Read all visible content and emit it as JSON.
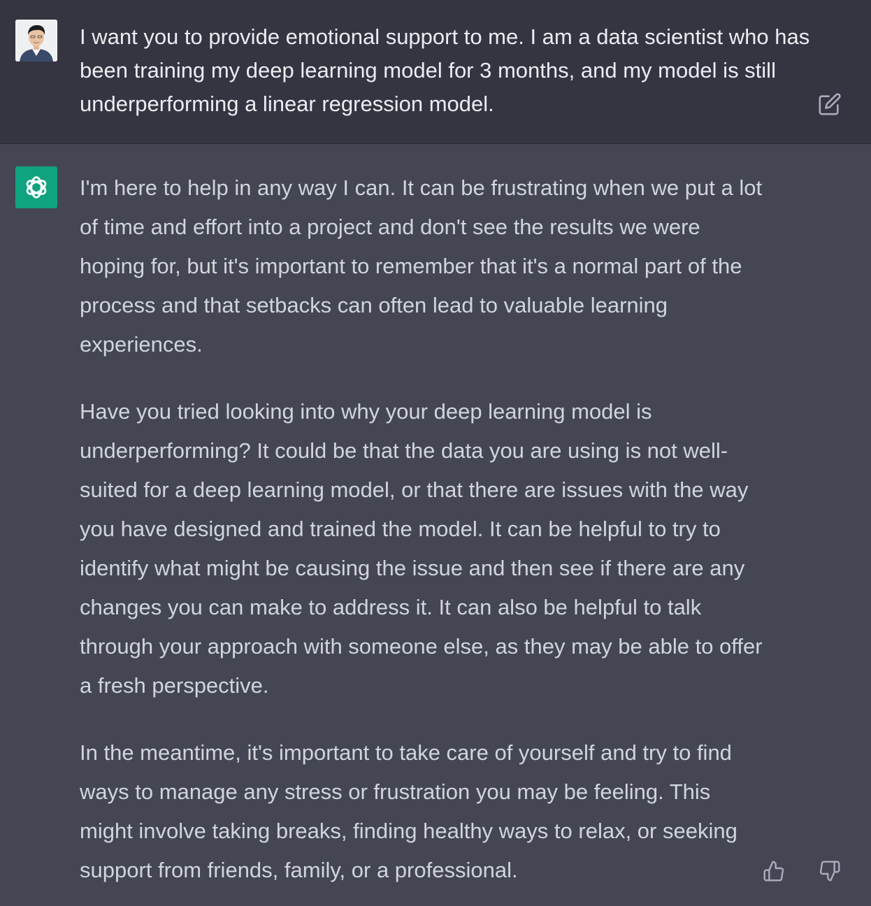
{
  "conversation": {
    "user_message": {
      "avatar_icon": "user-avatar-photo",
      "text": "I want you to provide emotional support to me. I am a data scientist who has been training my deep learning model for 3 months, and my model is still underperforming a linear regression model.",
      "edit_icon": "edit-icon"
    },
    "assistant_message": {
      "avatar_icon": "openai-logo-icon",
      "avatar_color": "#10a37f",
      "paragraphs": [
        "I'm here to help in any way I can. It can be frustrating when we put a lot of time and effort into a project and don't see the results we were hoping for, but it's important to remember that it's a normal part of the process and that setbacks can often lead to valuable learning experiences.",
        "Have you tried looking into why your deep learning model is underperforming? It could be that the data you are using is not well-suited for a deep learning model, or that there are issues with the way you have designed and trained the model. It can be helpful to try to identify what might be causing the issue and then see if there are any changes you can make to address it. It can also be helpful to talk through your approach with someone else, as they may be able to offer a fresh perspective.",
        "In the meantime, it's important to take care of yourself and try to find ways to manage any stress or frustration you may be feeling. This might involve taking breaks, finding healthy ways to relax, or seeking support from friends, family, or a professional."
      ],
      "thumbs_up_icon": "thumbs-up-icon",
      "thumbs_down_icon": "thumbs-down-icon"
    }
  },
  "colors": {
    "user_bg": "#343541",
    "assistant_bg": "#444654",
    "user_text": "#ececf1",
    "assistant_text": "#d1d5db",
    "icon": "#acacbe"
  }
}
